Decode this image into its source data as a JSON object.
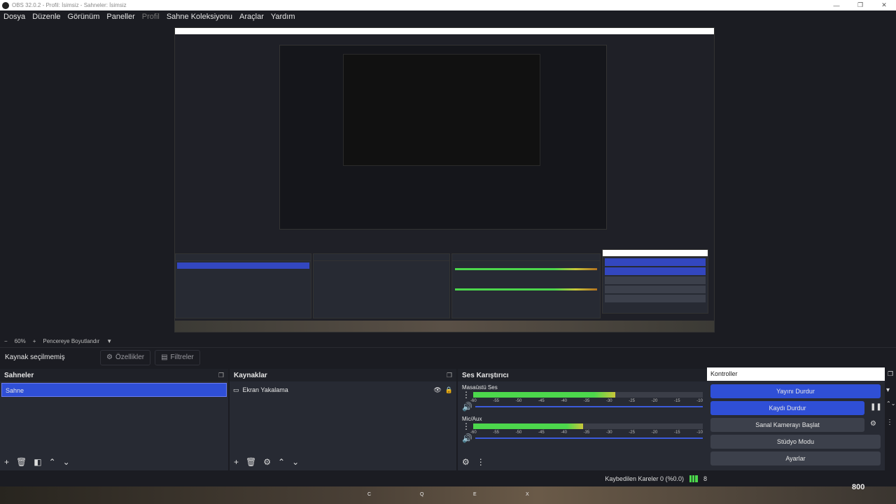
{
  "window": {
    "title": "OBS 32.0.2 - Profil: İsimsiz - Sahneler: İsimsiz"
  },
  "menu": [
    "Dosya",
    "Düzenle",
    "Görünüm",
    "Paneller",
    "Profil",
    "Sahne Koleksiyonu",
    "Araçlar",
    "Yardım"
  ],
  "zoom": {
    "minus": "−",
    "value": "60%",
    "plus": "+",
    "fit": "Pencereye Boyutlandır"
  },
  "properties_bar": {
    "no_source": "Kaynak seçilmemiş",
    "properties": "Özellikler",
    "filters": "Filtreler"
  },
  "scenes": {
    "title": "Sahneler",
    "items": [
      "Sahne"
    ]
  },
  "sources": {
    "title": "Kaynaklar",
    "items": [
      "Ekran Yakalama"
    ]
  },
  "mixer": {
    "title": "Ses Karıştırıcı",
    "channels": [
      {
        "name": "Masaüstü Ses",
        "level": 0.62
      },
      {
        "name": "Mic/Aux",
        "level": 0.48
      }
    ],
    "ticks": [
      "-60",
      "-55",
      "-50",
      "-45",
      "-40",
      "-35",
      "-30",
      "-25",
      "-20",
      "-15",
      "-10"
    ]
  },
  "controls": {
    "title": "Kontroller",
    "stop_stream": "Yayını Durdur",
    "stop_record": "Kaydı Durdur",
    "virtual_cam": "Sanal Kamerayı Başlat",
    "studio_mode": "Stüdyo Modu",
    "settings": "Ayarlar"
  },
  "status": {
    "dropped_frames": "Kaybedilen Kareler 0 (%0.0)",
    "bitrate_partial": "8"
  },
  "game_hud": {
    "keys": [
      "C",
      "Q",
      "E",
      "X"
    ],
    "ammo": "800"
  },
  "colors": {
    "accent": "#2f4fd6",
    "panel": "#272a33",
    "background": "#1b1c22",
    "meter_green": "#4cd74c",
    "meter_yellow": "#c9c73a"
  }
}
